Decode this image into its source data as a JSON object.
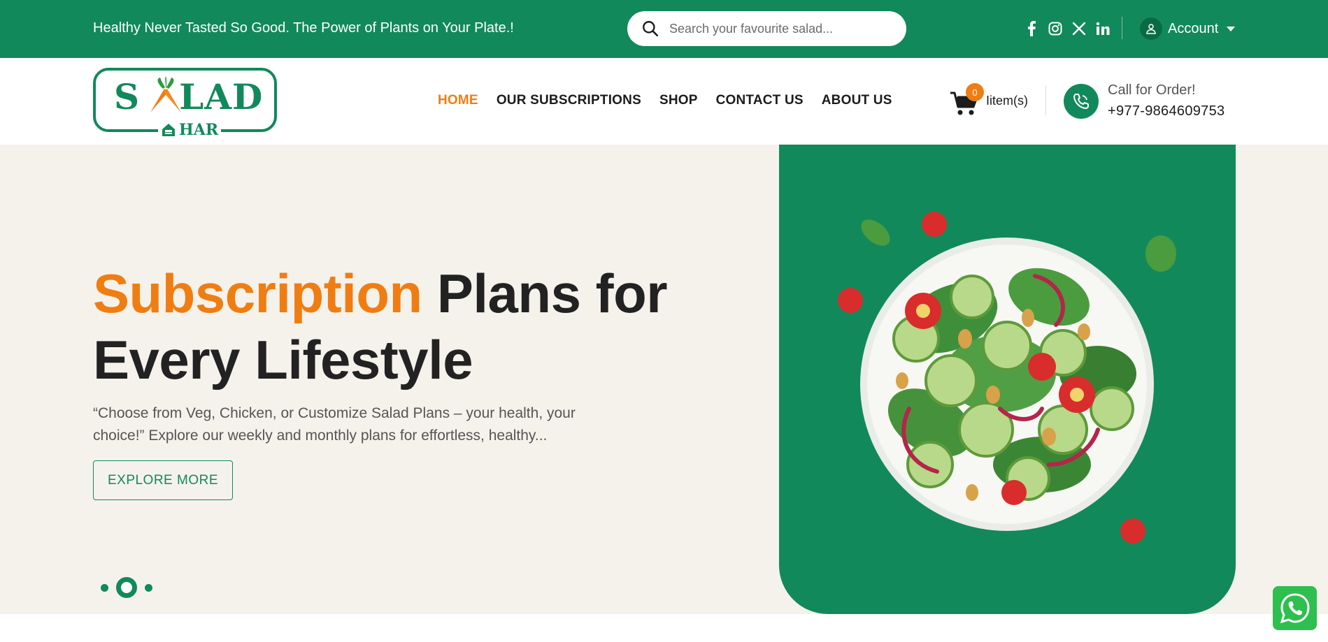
{
  "topbar": {
    "tagline": "Healthy Never Tasted So Good. The Power of Plants on Your Plate.!",
    "search_placeholder": "Search your favourite salad...",
    "socials": [
      "facebook-icon",
      "instagram-icon",
      "x-icon",
      "linkedin-icon"
    ],
    "account_label": "Account"
  },
  "logo": {
    "word": "SALAD",
    "sub": "HAR"
  },
  "nav": {
    "items": [
      {
        "label": "HOME",
        "active": true
      },
      {
        "label": "OUR SUBSCRIPTIONS",
        "active": false
      },
      {
        "label": "SHOP",
        "active": false
      },
      {
        "label": "CONTACT US",
        "active": false
      },
      {
        "label": "ABOUT US",
        "active": false
      }
    ]
  },
  "cart": {
    "count": "0",
    "label": "Iitem(s)"
  },
  "call": {
    "label": "Call for Order!",
    "number": "+977-9864609753"
  },
  "hero": {
    "title_highlight": "Subscription",
    "title_rest": " Plans for Every Lifestyle",
    "text": "“Choose from Veg, Chicken, or Customize Salad Plans – your health, your choice!” Explore our weekly and monthly plans for effortless, healthy...",
    "button_label": "EXPLORE MORE",
    "slide_count": 3,
    "active_slide": 2
  },
  "colors": {
    "brand_green": "#12895b",
    "accent_orange": "#f07d12",
    "hero_bg": "#f5f2ec",
    "whatsapp": "#2ebf4e"
  }
}
